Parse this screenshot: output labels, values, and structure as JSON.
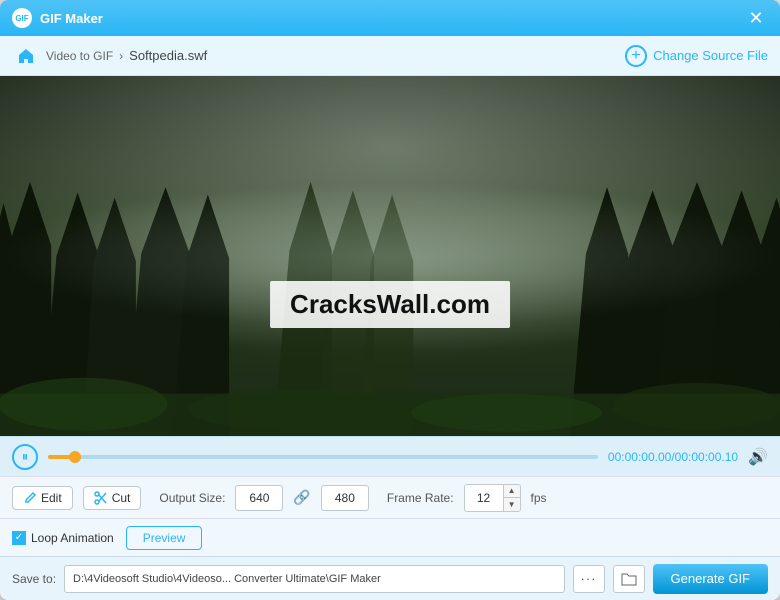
{
  "titlebar": {
    "title": "GIF Maker",
    "icon_label": "GIF"
  },
  "navbar": {
    "home_label": "⌂",
    "breadcrumb_1": "Video to GIF",
    "breadcrumb_sep": ">",
    "breadcrumb_2": "Softpedia.swf",
    "change_source_label": "Change Source File"
  },
  "video": {
    "watermark": "CracksWall.com"
  },
  "controls": {
    "play_icon": "⏸",
    "time_current": "00:00:00.00",
    "time_separator": "/",
    "time_total": "00:00:00.10",
    "volume_icon": "🔊"
  },
  "options": {
    "edit_label": "Edit",
    "cut_label": "Cut",
    "output_size_label": "Output Size:",
    "width_value": "640",
    "height_value": "480",
    "frame_rate_label": "Frame Rate:",
    "fps_value": "12",
    "fps_unit": "fps"
  },
  "loop": {
    "loop_label": "Loop Animation",
    "preview_label": "Preview"
  },
  "save": {
    "save_to_label": "Save to:",
    "save_path": "D:\\4Videosoft Studio\\4Videoso...  Converter Ultimate\\GIF Maker",
    "generate_label": "Generate GIF"
  }
}
